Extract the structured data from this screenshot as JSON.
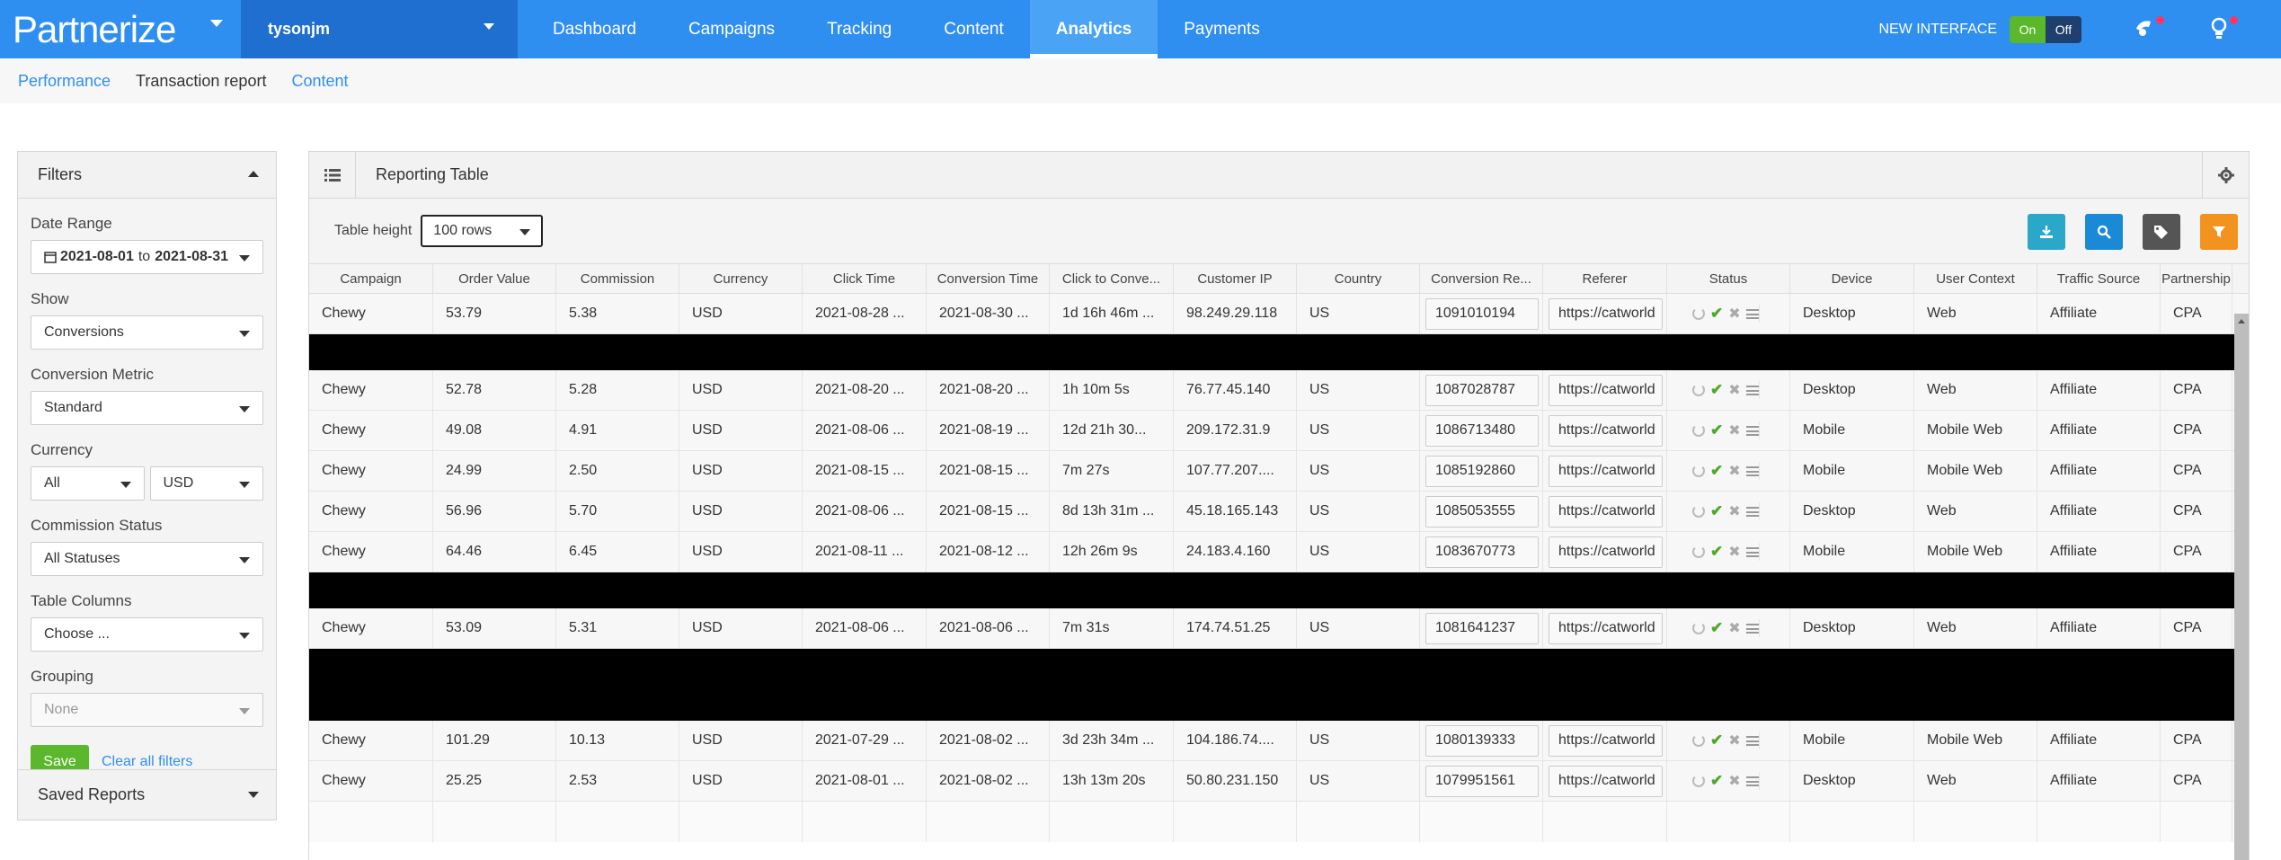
{
  "brand": {
    "name": "Partnerize"
  },
  "account": {
    "name": "tysonjm"
  },
  "nav": {
    "items": [
      "Dashboard",
      "Campaigns",
      "Tracking",
      "Content",
      "Analytics",
      "Payments"
    ],
    "active": "Analytics"
  },
  "top_right": {
    "new_interface": "NEW INTERFACE",
    "toggle_on": "On",
    "toggle_off": "Off"
  },
  "subnav": {
    "items": [
      "Performance",
      "Transaction report",
      "Content"
    ]
  },
  "filters": {
    "title": "Filters",
    "date_range_label": "Date Range",
    "date_from": "2021-08-01",
    "date_to_word": "to",
    "date_to": "2021-08-31",
    "show_label": "Show",
    "show_value": "Conversions",
    "conversion_metric_label": "Conversion Metric",
    "conversion_metric_value": "Standard",
    "currency_label": "Currency",
    "currency_value_a": "All",
    "currency_value_b": "USD",
    "commission_status_label": "Commission Status",
    "commission_status_value": "All Statuses",
    "table_columns_label": "Table Columns",
    "table_columns_value": "Choose ...",
    "grouping_label": "Grouping",
    "grouping_value": "None",
    "save_label": "Save",
    "clear_label": "Clear all filters",
    "saved_reports_label": "Saved Reports"
  },
  "report": {
    "title": "Reporting Table",
    "table_height_label": "Table height",
    "table_height_value": "100 rows",
    "columns": [
      "Campaign",
      "Order Value",
      "Commission",
      "Currency",
      "Click Time",
      "Conversion Time",
      "Click to Conve...",
      "Customer IP",
      "Country",
      "Conversion Re...",
      "Referer",
      "Status",
      "Device",
      "User Context",
      "Traffic Source",
      "Partnership"
    ],
    "rows": [
      {
        "campaign": "Chewy",
        "order_value": "53.79",
        "commission": "5.38",
        "currency": "USD",
        "click_time": "2021-08-28 ...",
        "conversion_time": "2021-08-30 ...",
        "click_to_conv": "1d 16h 46m ...",
        "ip": "98.249.29.118",
        "country": "US",
        "conv_ref": "1091010194",
        "referer": "https://catworld",
        "device": "Desktop",
        "user_context": "Web",
        "traffic_source": "Affiliate",
        "partnership": "CPA"
      },
      {
        "redacted": true
      },
      {
        "campaign": "Chewy",
        "order_value": "52.78",
        "commission": "5.28",
        "currency": "USD",
        "click_time": "2021-08-20 ...",
        "conversion_time": "2021-08-20 ...",
        "click_to_conv": "1h 10m 5s",
        "ip": "76.77.45.140",
        "country": "US",
        "conv_ref": "1087028787",
        "referer": "https://catworld",
        "device": "Desktop",
        "user_context": "Web",
        "traffic_source": "Affiliate",
        "partnership": "CPA"
      },
      {
        "campaign": "Chewy",
        "order_value": "49.08",
        "commission": "4.91",
        "currency": "USD",
        "click_time": "2021-08-06 ...",
        "conversion_time": "2021-08-19 ...",
        "click_to_conv": "12d 21h 30...",
        "ip": "209.172.31.9",
        "country": "US",
        "conv_ref": "1086713480",
        "referer": "https://catworld",
        "device": "Mobile",
        "user_context": "Mobile Web",
        "traffic_source": "Affiliate",
        "partnership": "CPA"
      },
      {
        "campaign": "Chewy",
        "order_value": "24.99",
        "commission": "2.50",
        "currency": "USD",
        "click_time": "2021-08-15 ...",
        "conversion_time": "2021-08-15 ...",
        "click_to_conv": "7m 27s",
        "ip": "107.77.207....",
        "country": "US",
        "conv_ref": "1085192860",
        "referer": "https://catworld",
        "device": "Mobile",
        "user_context": "Mobile Web",
        "traffic_source": "Affiliate",
        "partnership": "CPA"
      },
      {
        "campaign": "Chewy",
        "order_value": "56.96",
        "commission": "5.70",
        "currency": "USD",
        "click_time": "2021-08-06 ...",
        "conversion_time": "2021-08-15 ...",
        "click_to_conv": "8d 13h 31m ...",
        "ip": "45.18.165.143",
        "country": "US",
        "conv_ref": "1085053555",
        "referer": "https://catworld",
        "device": "Desktop",
        "user_context": "Web",
        "traffic_source": "Affiliate",
        "partnership": "CPA"
      },
      {
        "campaign": "Chewy",
        "order_value": "64.46",
        "commission": "6.45",
        "currency": "USD",
        "click_time": "2021-08-11 ...",
        "conversion_time": "2021-08-12 ...",
        "click_to_conv": "12h 26m 9s",
        "ip": "24.183.4.160",
        "country": "US",
        "conv_ref": "1083670773",
        "referer": "https://catworld",
        "device": "Mobile",
        "user_context": "Mobile Web",
        "traffic_source": "Affiliate",
        "partnership": "CPA"
      },
      {
        "redacted": true
      },
      {
        "campaign": "Chewy",
        "order_value": "53.09",
        "commission": "5.31",
        "currency": "USD",
        "click_time": "2021-08-06 ...",
        "conversion_time": "2021-08-06 ...",
        "click_to_conv": "7m 31s",
        "ip": "174.74.51.25",
        "country": "US",
        "conv_ref": "1081641237",
        "referer": "https://catworld",
        "device": "Desktop",
        "user_context": "Web",
        "traffic_source": "Affiliate",
        "partnership": "CPA"
      },
      {
        "redacted": true
      },
      {
        "redacted": true
      },
      {
        "campaign": "Chewy",
        "order_value": "101.29",
        "commission": "10.13",
        "currency": "USD",
        "click_time": "2021-07-29 ...",
        "conversion_time": "2021-08-02 ...",
        "click_to_conv": "3d 23h 34m ...",
        "ip": "104.186.74....",
        "country": "US",
        "conv_ref": "1080139333",
        "referer": "https://catworld",
        "device": "Mobile",
        "user_context": "Mobile Web",
        "traffic_source": "Affiliate",
        "partnership": "CPA"
      },
      {
        "campaign": "Chewy",
        "order_value": "25.25",
        "commission": "2.53",
        "currency": "USD",
        "click_time": "2021-08-01 ...",
        "conversion_time": "2021-08-02 ...",
        "click_to_conv": "13h 13m 20s",
        "ip": "50.80.231.150",
        "country": "US",
        "conv_ref": "1079951561",
        "referer": "https://catworld",
        "device": "Desktop",
        "user_context": "Web",
        "traffic_source": "Affiliate",
        "partnership": "CPA"
      }
    ]
  },
  "colors": {
    "primary": "#2f8ff0",
    "account_bg": "#1f6fd0",
    "success": "#5bb82c",
    "teal": "#2aa7c9",
    "orange": "#f3931f"
  }
}
